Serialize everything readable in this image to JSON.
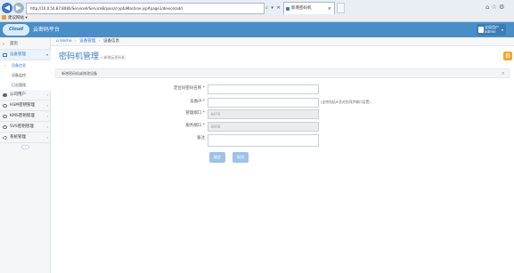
{
  "browser": {
    "back_icon": "back-arrow-icon",
    "address": "http://10.0.54.87:8080/ServiceA/ServiceB/pass/cryptoMachine.jsp#page1/device/add",
    "address_controls": "⌕ ▾ ✕",
    "tab_title": "新增密码机",
    "favorites_label": "建议网站 ▾",
    "window_controls": "⌂ ☆ ⚙"
  },
  "header": {
    "logo_text": "Cloud",
    "app_title": "云密码平台",
    "user_name": "全局用户",
    "user_role": "admin",
    "user_caret": "▾"
  },
  "sidebar": {
    "items": [
      {
        "label": "首页",
        "icon": "home-icon"
      },
      {
        "label": "设备管理",
        "icon": "monitor-icon",
        "arrow": "▾"
      },
      {
        "label": "设备信息"
      },
      {
        "label": "设备监控"
      },
      {
        "label": "日志管理"
      },
      {
        "label": "公司用户",
        "icon": "users-icon",
        "arrow": "‹"
      },
      {
        "label": "HSM密钥管理",
        "icon": "key-icon",
        "arrow": "‹"
      },
      {
        "label": "KMS密钥管理",
        "icon": "key-icon",
        "arrow": "‹"
      },
      {
        "label": "SVS密钥管理",
        "icon": "key-icon",
        "arrow": "‹"
      },
      {
        "label": "系统管理",
        "icon": "gear-icon",
        "arrow": "‹"
      }
    ],
    "collapse": "«"
  },
  "breadcrumb": {
    "home": "Home",
    "sep": "›",
    "level1": "设备管理",
    "level2": "设备信息"
  },
  "page": {
    "title": "密码机管理",
    "subtitle": "» 新增云密码机",
    "alert_text": "新增密码机或修改设备",
    "alert_close": "×"
  },
  "form": {
    "fields": [
      {
        "label": "定位码密码名称 *",
        "value": ""
      },
      {
        "label": "设备IP *",
        "value": ""
      },
      {
        "label": "管理端口 *",
        "value": "8070"
      },
      {
        "label": "服务端口 *",
        "value": "8008"
      },
      {
        "label": "备注",
        "value": ""
      }
    ],
    "ip_hint": "(支持包括IP及对应同步端口设置)",
    "submit_label": "确定",
    "cancel_label": "取消"
  },
  "colors": {
    "accent": "#4a8ec7",
    "title": "#3a78c9",
    "gear": "#f0a830",
    "button": "#9dc3e6"
  }
}
